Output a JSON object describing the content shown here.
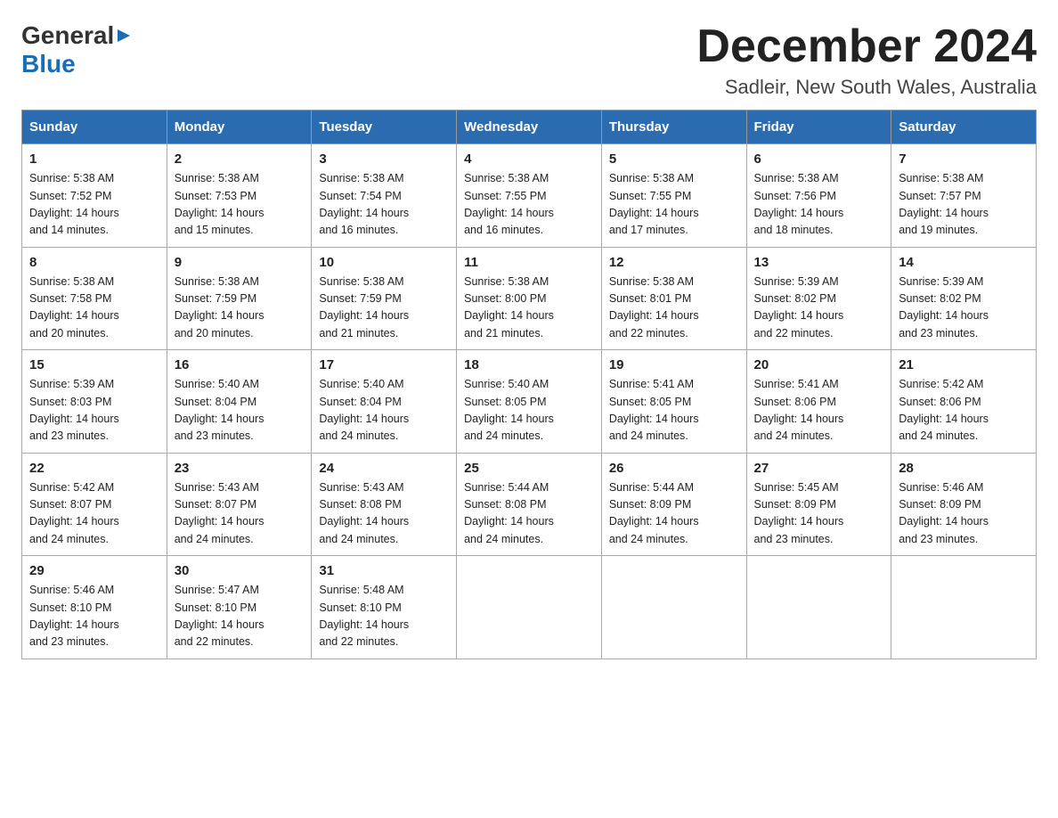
{
  "header": {
    "logo_general": "General",
    "logo_blue": "Blue",
    "month_title": "December 2024",
    "location": "Sadleir, New South Wales, Australia"
  },
  "weekdays": [
    "Sunday",
    "Monday",
    "Tuesday",
    "Wednesday",
    "Thursday",
    "Friday",
    "Saturday"
  ],
  "weeks": [
    [
      {
        "day": "1",
        "sunrise": "5:38 AM",
        "sunset": "7:52 PM",
        "daylight": "14 hours and 14 minutes."
      },
      {
        "day": "2",
        "sunrise": "5:38 AM",
        "sunset": "7:53 PM",
        "daylight": "14 hours and 15 minutes."
      },
      {
        "day": "3",
        "sunrise": "5:38 AM",
        "sunset": "7:54 PM",
        "daylight": "14 hours and 16 minutes."
      },
      {
        "day": "4",
        "sunrise": "5:38 AM",
        "sunset": "7:55 PM",
        "daylight": "14 hours and 16 minutes."
      },
      {
        "day": "5",
        "sunrise": "5:38 AM",
        "sunset": "7:55 PM",
        "daylight": "14 hours and 17 minutes."
      },
      {
        "day": "6",
        "sunrise": "5:38 AM",
        "sunset": "7:56 PM",
        "daylight": "14 hours and 18 minutes."
      },
      {
        "day": "7",
        "sunrise": "5:38 AM",
        "sunset": "7:57 PM",
        "daylight": "14 hours and 19 minutes."
      }
    ],
    [
      {
        "day": "8",
        "sunrise": "5:38 AM",
        "sunset": "7:58 PM",
        "daylight": "14 hours and 20 minutes."
      },
      {
        "day": "9",
        "sunrise": "5:38 AM",
        "sunset": "7:59 PM",
        "daylight": "14 hours and 20 minutes."
      },
      {
        "day": "10",
        "sunrise": "5:38 AM",
        "sunset": "7:59 PM",
        "daylight": "14 hours and 21 minutes."
      },
      {
        "day": "11",
        "sunrise": "5:38 AM",
        "sunset": "8:00 PM",
        "daylight": "14 hours and 21 minutes."
      },
      {
        "day": "12",
        "sunrise": "5:38 AM",
        "sunset": "8:01 PM",
        "daylight": "14 hours and 22 minutes."
      },
      {
        "day": "13",
        "sunrise": "5:39 AM",
        "sunset": "8:02 PM",
        "daylight": "14 hours and 22 minutes."
      },
      {
        "day": "14",
        "sunrise": "5:39 AM",
        "sunset": "8:02 PM",
        "daylight": "14 hours and 23 minutes."
      }
    ],
    [
      {
        "day": "15",
        "sunrise": "5:39 AM",
        "sunset": "8:03 PM",
        "daylight": "14 hours and 23 minutes."
      },
      {
        "day": "16",
        "sunrise": "5:40 AM",
        "sunset": "8:04 PM",
        "daylight": "14 hours and 23 minutes."
      },
      {
        "day": "17",
        "sunrise": "5:40 AM",
        "sunset": "8:04 PM",
        "daylight": "14 hours and 24 minutes."
      },
      {
        "day": "18",
        "sunrise": "5:40 AM",
        "sunset": "8:05 PM",
        "daylight": "14 hours and 24 minutes."
      },
      {
        "day": "19",
        "sunrise": "5:41 AM",
        "sunset": "8:05 PM",
        "daylight": "14 hours and 24 minutes."
      },
      {
        "day": "20",
        "sunrise": "5:41 AM",
        "sunset": "8:06 PM",
        "daylight": "14 hours and 24 minutes."
      },
      {
        "day": "21",
        "sunrise": "5:42 AM",
        "sunset": "8:06 PM",
        "daylight": "14 hours and 24 minutes."
      }
    ],
    [
      {
        "day": "22",
        "sunrise": "5:42 AM",
        "sunset": "8:07 PM",
        "daylight": "14 hours and 24 minutes."
      },
      {
        "day": "23",
        "sunrise": "5:43 AM",
        "sunset": "8:07 PM",
        "daylight": "14 hours and 24 minutes."
      },
      {
        "day": "24",
        "sunrise": "5:43 AM",
        "sunset": "8:08 PM",
        "daylight": "14 hours and 24 minutes."
      },
      {
        "day": "25",
        "sunrise": "5:44 AM",
        "sunset": "8:08 PM",
        "daylight": "14 hours and 24 minutes."
      },
      {
        "day": "26",
        "sunrise": "5:44 AM",
        "sunset": "8:09 PM",
        "daylight": "14 hours and 24 minutes."
      },
      {
        "day": "27",
        "sunrise": "5:45 AM",
        "sunset": "8:09 PM",
        "daylight": "14 hours and 23 minutes."
      },
      {
        "day": "28",
        "sunrise": "5:46 AM",
        "sunset": "8:09 PM",
        "daylight": "14 hours and 23 minutes."
      }
    ],
    [
      {
        "day": "29",
        "sunrise": "5:46 AM",
        "sunset": "8:10 PM",
        "daylight": "14 hours and 23 minutes."
      },
      {
        "day": "30",
        "sunrise": "5:47 AM",
        "sunset": "8:10 PM",
        "daylight": "14 hours and 22 minutes."
      },
      {
        "day": "31",
        "sunrise": "5:48 AM",
        "sunset": "8:10 PM",
        "daylight": "14 hours and 22 minutes."
      },
      null,
      null,
      null,
      null
    ]
  ],
  "labels": {
    "sunrise": "Sunrise:",
    "sunset": "Sunset:",
    "daylight": "Daylight:"
  }
}
